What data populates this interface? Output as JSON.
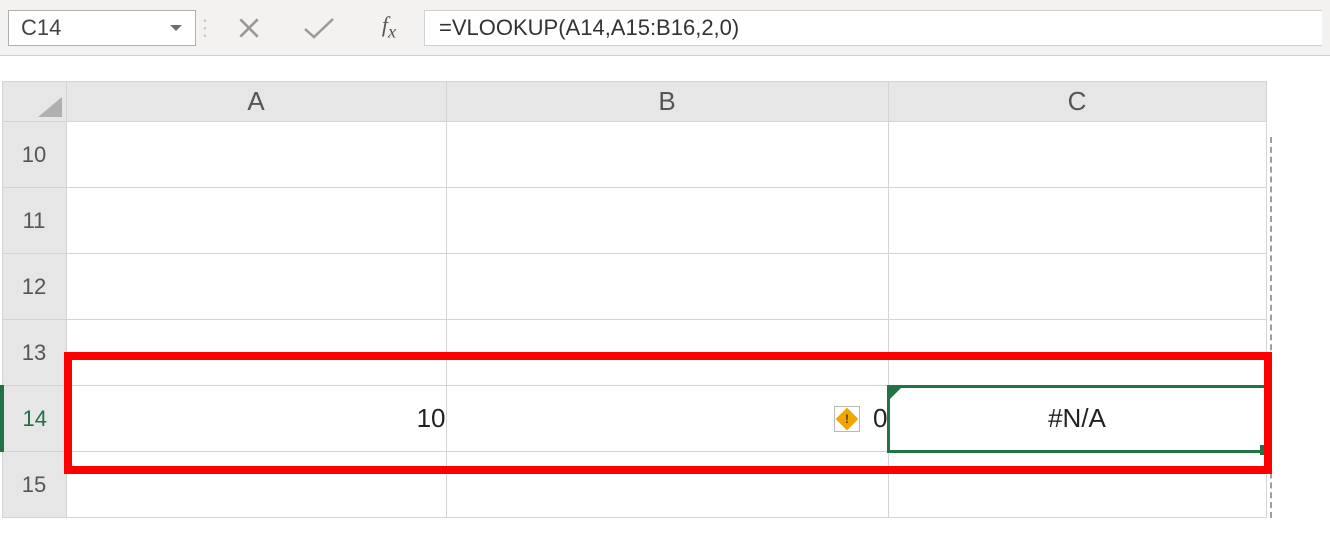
{
  "nameBox": {
    "value": "C14"
  },
  "formulaBar": {
    "formula": "=VLOOKUP(A14,A15:B16,2,0)"
  },
  "columns": {
    "A": "A",
    "B": "B",
    "C": "C"
  },
  "rows": {
    "r10": {
      "header": "10",
      "A": "",
      "B": "",
      "C": ""
    },
    "r11": {
      "header": "11",
      "A": "",
      "B": "",
      "C": ""
    },
    "r12": {
      "header": "12",
      "A": "",
      "B": "",
      "C": ""
    },
    "r13": {
      "header": "13",
      "A": "",
      "B": "",
      "C": ""
    },
    "r14": {
      "header": "14",
      "A": "10",
      "B": "0",
      "C": "#N/A"
    },
    "r15": {
      "header": "15",
      "A": "",
      "B": "",
      "C": ""
    }
  },
  "activeCell": "C14",
  "errorCell": "B14",
  "icons": {
    "dropdown": "chevron-down-icon",
    "cancel": "x-icon",
    "enter": "check-icon",
    "fx": "fx-icon",
    "error": "warning-diamond-icon"
  },
  "annotation": {
    "note": "red box around A14:C14"
  }
}
